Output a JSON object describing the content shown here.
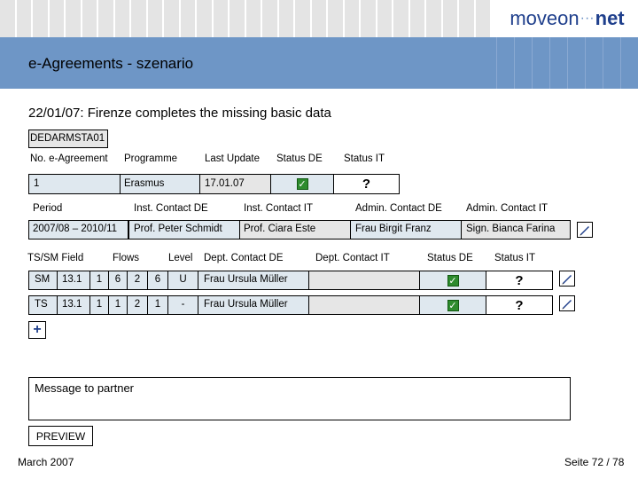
{
  "logo": {
    "part1": "moveon",
    "dots": "···",
    "part2": "net"
  },
  "title": "e-Agreements - szenario",
  "subtitle": "22/01/07: Firenze completes the missing basic data",
  "agreement_code": "DEDARMSTA01",
  "agreement_headers": {
    "no": "No. e-Agreement",
    "programme": "Programme",
    "last_update": "Last Update",
    "status_de": "Status DE",
    "status_it": "Status IT"
  },
  "agreement_row": {
    "no": "1",
    "programme": "Erasmus",
    "last_update": "17.01.07",
    "status_it": "?"
  },
  "contact_headers": {
    "period": "Period",
    "inst_de": "Inst. Contact DE",
    "inst_it": "Inst. Contact IT",
    "admin_de": "Admin. Contact DE",
    "admin_it": "Admin. Contact IT"
  },
  "contact_row": {
    "period": "2007/08 – 2010/11",
    "inst_de": "Prof. Peter Schmidt",
    "inst_it": "Prof. Ciara Este",
    "admin_de": "Frau Birgit Franz",
    "admin_it": "Sign. Bianca Farina"
  },
  "flow_headers": {
    "ts_sm_field": "TS/SM Field",
    "flows": "Flows",
    "level": "Level",
    "dept_de": "Dept. Contact DE",
    "dept_it": "Dept. Contact IT",
    "status_de": "Status DE",
    "status_it": "Status IT"
  },
  "flow_rows": [
    {
      "type": "SM",
      "field": "13.1",
      "f1": "1",
      "f2": "6",
      "f3": "2",
      "f4": "6",
      "level": "U",
      "dept_de": "Frau Ursula Müller",
      "dept_it": "",
      "status_it": "?"
    },
    {
      "type": "TS",
      "field": "13.1",
      "f1": "1",
      "f2": "1",
      "f3": "2",
      "f4": "1",
      "level": "-",
      "dept_de": "Frau Ursula Müller",
      "dept_it": "",
      "status_it": "?"
    }
  ],
  "add_label": "+",
  "message_placeholder": "Message to partner",
  "preview_label": "PREVIEW",
  "footer": {
    "date": "March 2007",
    "page": "Seite 72 / 78"
  },
  "colors": {
    "header_blue": "#6e96c6",
    "cell_light": "#dfe8ef",
    "cell_gray": "#e6e6e6",
    "check_green": "#2e8b2e"
  }
}
